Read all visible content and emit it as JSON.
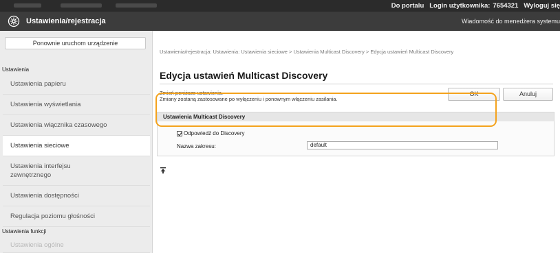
{
  "topbar": {
    "portal_link": "Do portalu",
    "login_label": "Login użytkownika:",
    "user_id": "7654321",
    "logout_link": "Wyloguj się"
  },
  "header": {
    "title": "Ustawienia/rejestracja",
    "message_link": "Wiadomość do menedżera systemu"
  },
  "sidebar": {
    "restart_button": "Ponownie uruchom urządzenie",
    "section_settings": "Ustawienia",
    "items": [
      {
        "label": "Ustawienia papieru"
      },
      {
        "label": "Ustawienia wyświetlania"
      },
      {
        "label": "Ustawienia włącznika czasowego"
      },
      {
        "label": "Ustawienia sieciowe"
      },
      {
        "label": "Ustawienia interfejsu zewnętrznego"
      },
      {
        "label": "Ustawienia dostępności"
      },
      {
        "label": "Regulacja poziomu głośności"
      }
    ],
    "section_functions": "Ustawienia funkcji",
    "dim_item": "Ustawienia ogólne"
  },
  "main": {
    "breadcrumb": "Ustawienia/rejestracja: Ustawienia: Ustawienia sieciowe > Ustawienia Multicast Discovery > Edycja ustawień Multicast Discovery",
    "title": "Edycja ustawień Multicast Discovery",
    "desc_line1": "Zmień poniższe ustawienia.",
    "desc_line2": "Zmiany zostaną zastosowane po wyłączeniu i ponownym włączeniu zasilania.",
    "ok_button": "OK",
    "cancel_button": "Anuluj",
    "panel": {
      "heading": "Ustawienia Multicast Discovery",
      "checkbox_label": "Odpowiedź do Discovery",
      "checkbox_checked": true,
      "scope_label": "Nazwa zakresu:",
      "scope_value": "default"
    }
  },
  "colors": {
    "highlight": "#f4a21c",
    "topbar": "#2b2b2b",
    "titlebar": "#3c3c3c"
  }
}
